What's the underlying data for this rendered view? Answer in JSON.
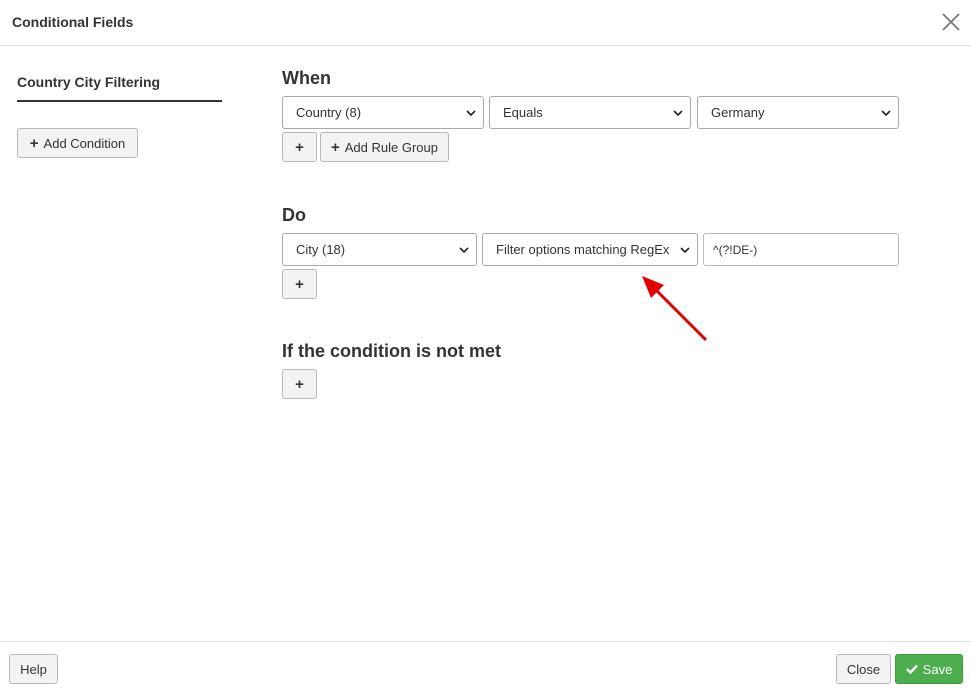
{
  "dialog": {
    "title": "Conditional Fields"
  },
  "sidebar": {
    "tab_label": "Country City Filtering",
    "add_condition_label": "Add Condition"
  },
  "when": {
    "heading": "When",
    "field": "Country (8)",
    "operator": "Equals",
    "value": "Germany",
    "add_rule_group_label": "Add Rule Group"
  },
  "do": {
    "heading": "Do",
    "field": "City (18)",
    "action": "Filter options matching RegEx",
    "regex_value": "^(?!DE-)"
  },
  "else": {
    "heading": "If the condition is not met"
  },
  "footer": {
    "help_label": "Help",
    "close_label": "Close",
    "save_label": "Save"
  },
  "colors": {
    "save_button": "#4cae4c",
    "annotation_arrow": "#e00000"
  }
}
